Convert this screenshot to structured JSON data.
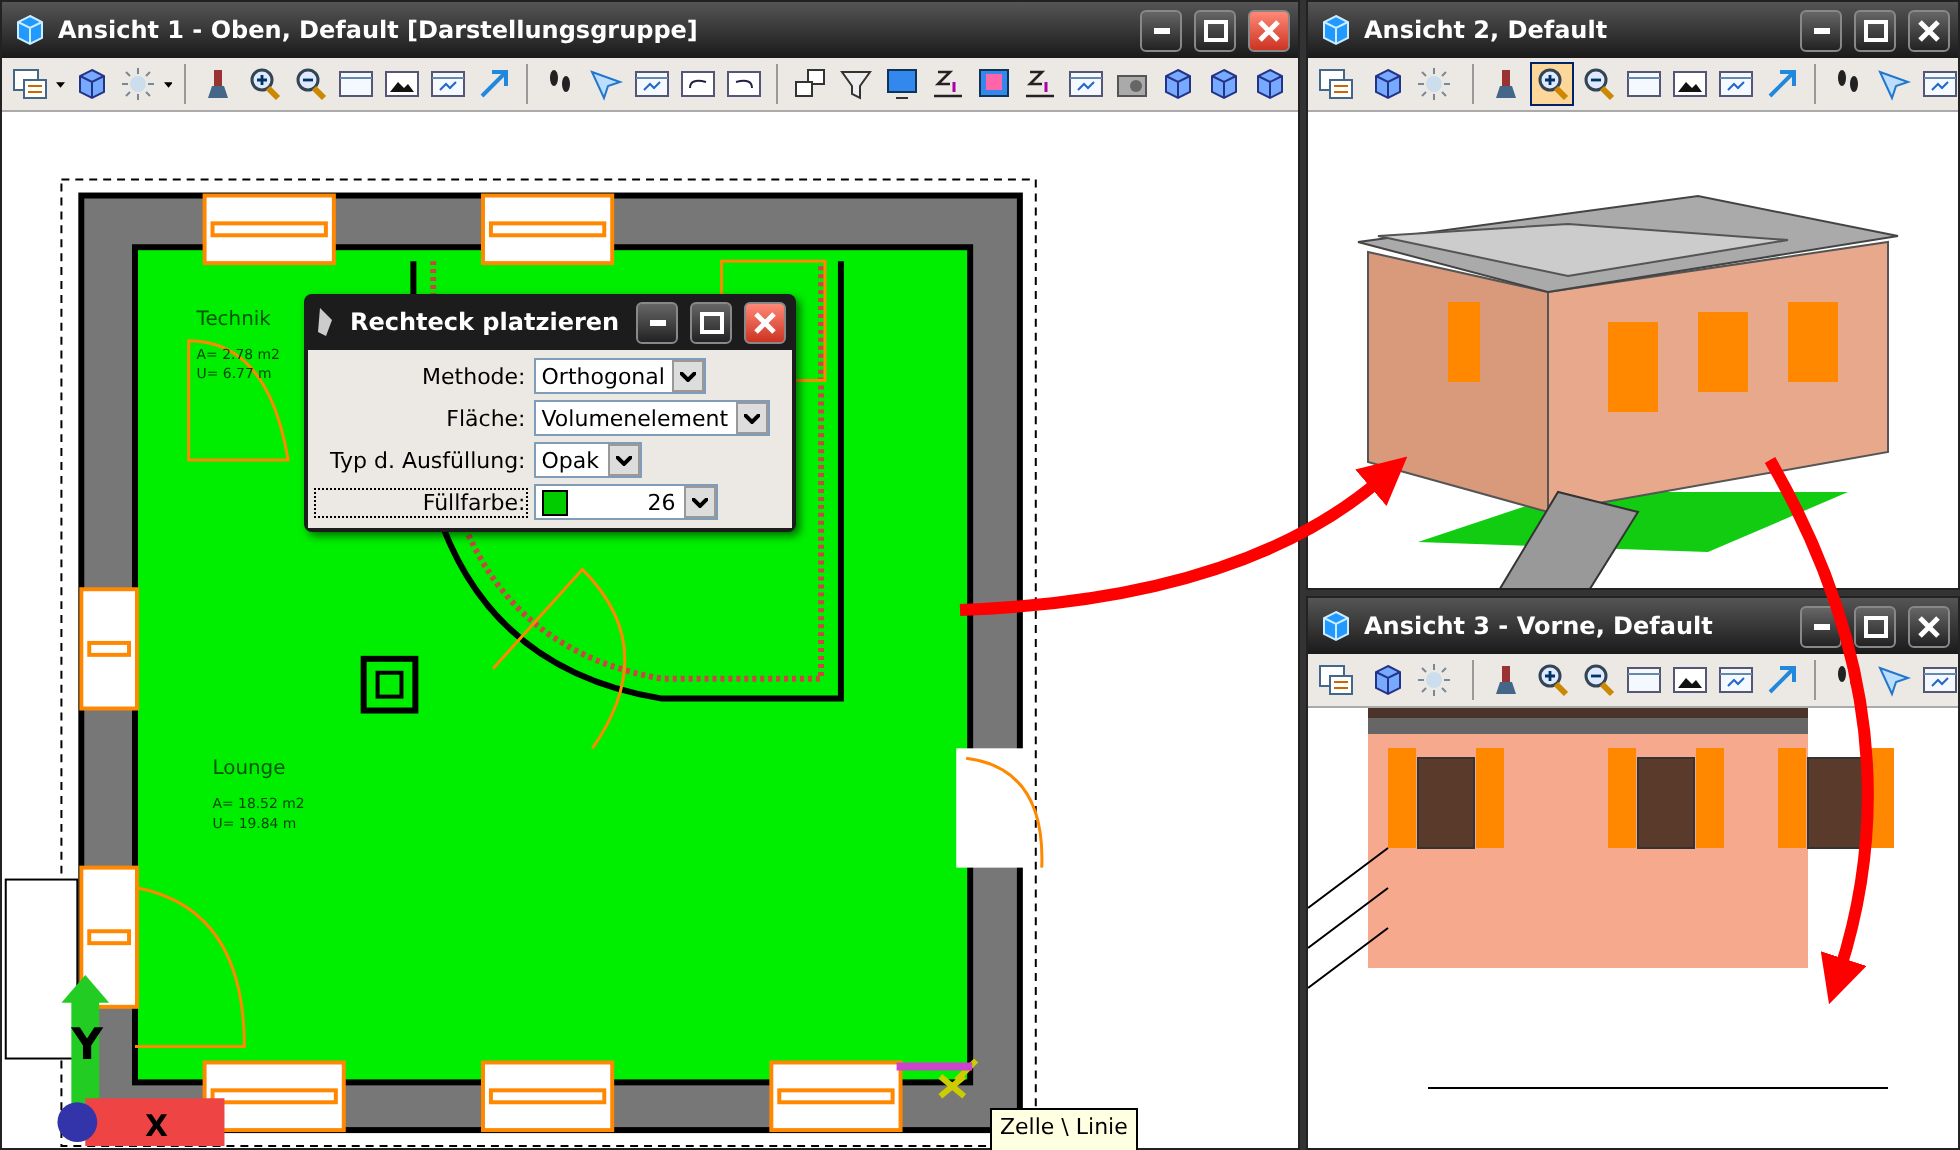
{
  "windows": [
    {
      "title": "Ansicht 1 - Oben, Default [Darstellungsgruppe]",
      "close_highlighted": true,
      "zoom_in_active": false
    },
    {
      "title": "Ansicht 2, Default",
      "close_highlighted": false,
      "zoom_in_active": true
    },
    {
      "title": "Ansicht 3 - Vorne, Default",
      "close_highlighted": false,
      "zoom_in_active": false
    }
  ],
  "rooms": [
    {
      "name": "Technik",
      "area": "A= 2.78 m2",
      "perimeter": "U= 6.77 m"
    },
    {
      "name": "Lounge",
      "area": "A= 18.52 m2",
      "perimeter": "U= 19.84 m"
    }
  ],
  "axes": {
    "y": "Y",
    "x": "X"
  },
  "dialog": {
    "title": "Rechteck platzieren",
    "fields": [
      {
        "kind": "select",
        "label": "Methode:",
        "value": "Orthogonal",
        "focused": false
      },
      {
        "kind": "select",
        "label": "Fläche:",
        "value": "Volumenelement",
        "focused": false
      },
      {
        "kind": "select",
        "label": "Typ d. Ausfüllung:",
        "value": "Opak",
        "focused": false
      },
      {
        "kind": "color",
        "label": "Füllfarbe:",
        "value": "26",
        "color": "#00cc00",
        "focused": true
      }
    ]
  },
  "tooltip": {
    "text": "Zelle \\ Linie"
  }
}
